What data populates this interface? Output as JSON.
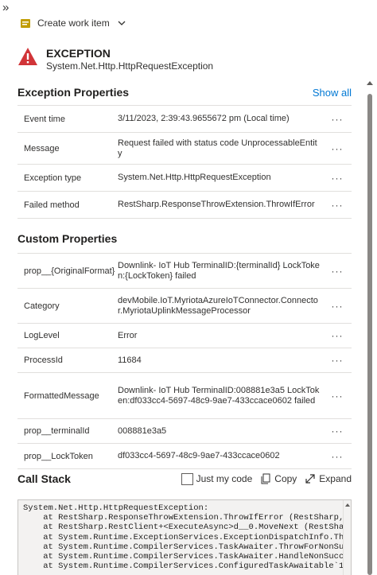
{
  "toolbar": {
    "create_work_item_label": "Create work item"
  },
  "exception": {
    "title": "EXCEPTION",
    "type": "System.Net.Http.HttpRequestException"
  },
  "exception_properties": {
    "heading": "Exception Properties",
    "show_all": "Show all",
    "rows": [
      {
        "key": "Event time",
        "value": "3/11/2023, 2:39:43.9655672 pm (Local time)"
      },
      {
        "key": "Message",
        "value": "Request failed with status code UnprocessableEntity"
      },
      {
        "key": "Exception type",
        "value": "System.Net.Http.HttpRequestException"
      },
      {
        "key": "Failed method",
        "value": "RestSharp.ResponseThrowExtension.ThrowIfError"
      }
    ]
  },
  "custom_properties": {
    "heading": "Custom Properties",
    "rows": [
      {
        "key": "prop__{OriginalFormat}",
        "value": "Downlink- IoT Hub TerminalID:{terminalId} LockToken:{LockToken} failed"
      },
      {
        "key": "Category",
        "value": "devMobile.IoT.MyriotaAzureIoTConnector.Connector.MyriotaUplinkMessageProcessor"
      },
      {
        "key": "LogLevel",
        "value": "Error"
      },
      {
        "key": "ProcessId",
        "value": "11684"
      },
      {
        "key": "FormattedMessage",
        "value": "Downlink- IoT Hub TerminalID:008881e3a5 LockToken:df033cc4-5697-48c9-9ae7-433ccace0602 failed"
      },
      {
        "key": "prop__terminalId",
        "value": "008881e3a5"
      },
      {
        "key": "prop__LockToken",
        "value": "df033cc4-5697-48c9-9ae7-433ccace0602"
      }
    ]
  },
  "call_stack": {
    "heading": "Call Stack",
    "just_my_code": "Just my code",
    "copy": "Copy",
    "expand": "Expand",
    "text": "System.Net.Http.HttpRequestException:\n    at RestSharp.ResponseThrowExtension.ThrowIfError (RestSharp, Vers\n    at RestSharp.RestClient+<ExecuteAsync>d__0.MoveNext (RestSharp, V\n    at System.Runtime.ExceptionServices.ExceptionDispatchInfo.Throw (\n    at System.Runtime.CompilerServices.TaskAwaiter.ThrowForNonSuccess\n    at System.Runtime.CompilerServices.TaskAwaiter.HandleNonSuccessAn\n    at System.Runtime.CompilerServices.ConfiguredTaskAwaitable`1+Conf"
  },
  "more_glyph": "···",
  "colors": {
    "accent": "#0078d4",
    "error": "#d13438"
  }
}
